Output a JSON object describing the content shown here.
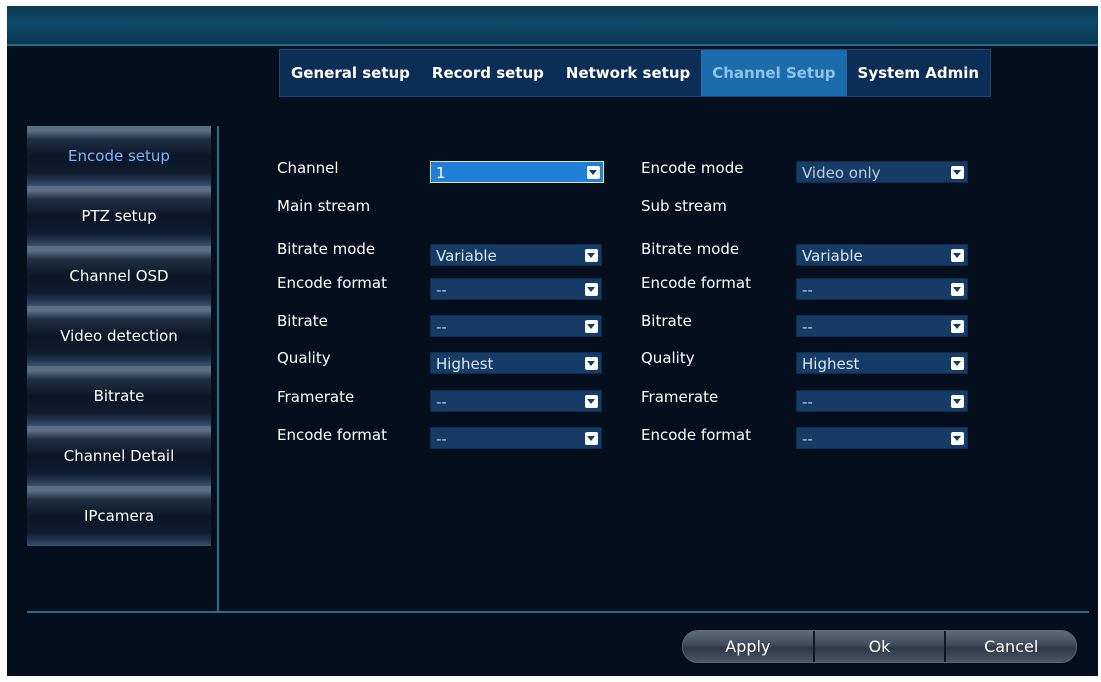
{
  "tabs": [
    {
      "label": "General setup",
      "active": false
    },
    {
      "label": "Record setup",
      "active": false
    },
    {
      "label": "Network setup",
      "active": false
    },
    {
      "label": "Channel Setup",
      "active": true
    },
    {
      "label": "System Admin",
      "active": false
    }
  ],
  "sidebar": {
    "items": [
      {
        "label": "Encode setup",
        "active": true
      },
      {
        "label": "PTZ setup",
        "active": false
      },
      {
        "label": "Channel OSD",
        "active": false
      },
      {
        "label": "Video detection",
        "active": false
      },
      {
        "label": "Bitrate",
        "active": false
      },
      {
        "label": "Channel Detail",
        "active": false
      },
      {
        "label": "IPcamera",
        "active": false
      }
    ]
  },
  "form": {
    "channel_label": "Channel",
    "channel_value": "1",
    "encode_mode_label": "Encode mode",
    "encode_mode_value": "Video only",
    "main_stream": {
      "heading": "Main stream",
      "rows": [
        {
          "label": "Bitrate mode",
          "value": "Variable"
        },
        {
          "label": "Encode format",
          "value": "--"
        },
        {
          "label": "Bitrate",
          "value": "--"
        },
        {
          "label": "Quality",
          "value": "Highest"
        },
        {
          "label": "Framerate",
          "value": "--"
        },
        {
          "label": "Encode format",
          "value": "--"
        }
      ]
    },
    "sub_stream": {
      "heading": "Sub stream",
      "rows": [
        {
          "label": "Bitrate mode",
          "value": "Variable"
        },
        {
          "label": "Encode format",
          "value": "--"
        },
        {
          "label": "Bitrate",
          "value": "--"
        },
        {
          "label": "Quality",
          "value": "Highest"
        },
        {
          "label": "Framerate",
          "value": "--"
        },
        {
          "label": "Encode format",
          "value": "--"
        }
      ]
    }
  },
  "buttons": {
    "apply": "Apply",
    "ok": "Ok",
    "cancel": "Cancel"
  }
}
